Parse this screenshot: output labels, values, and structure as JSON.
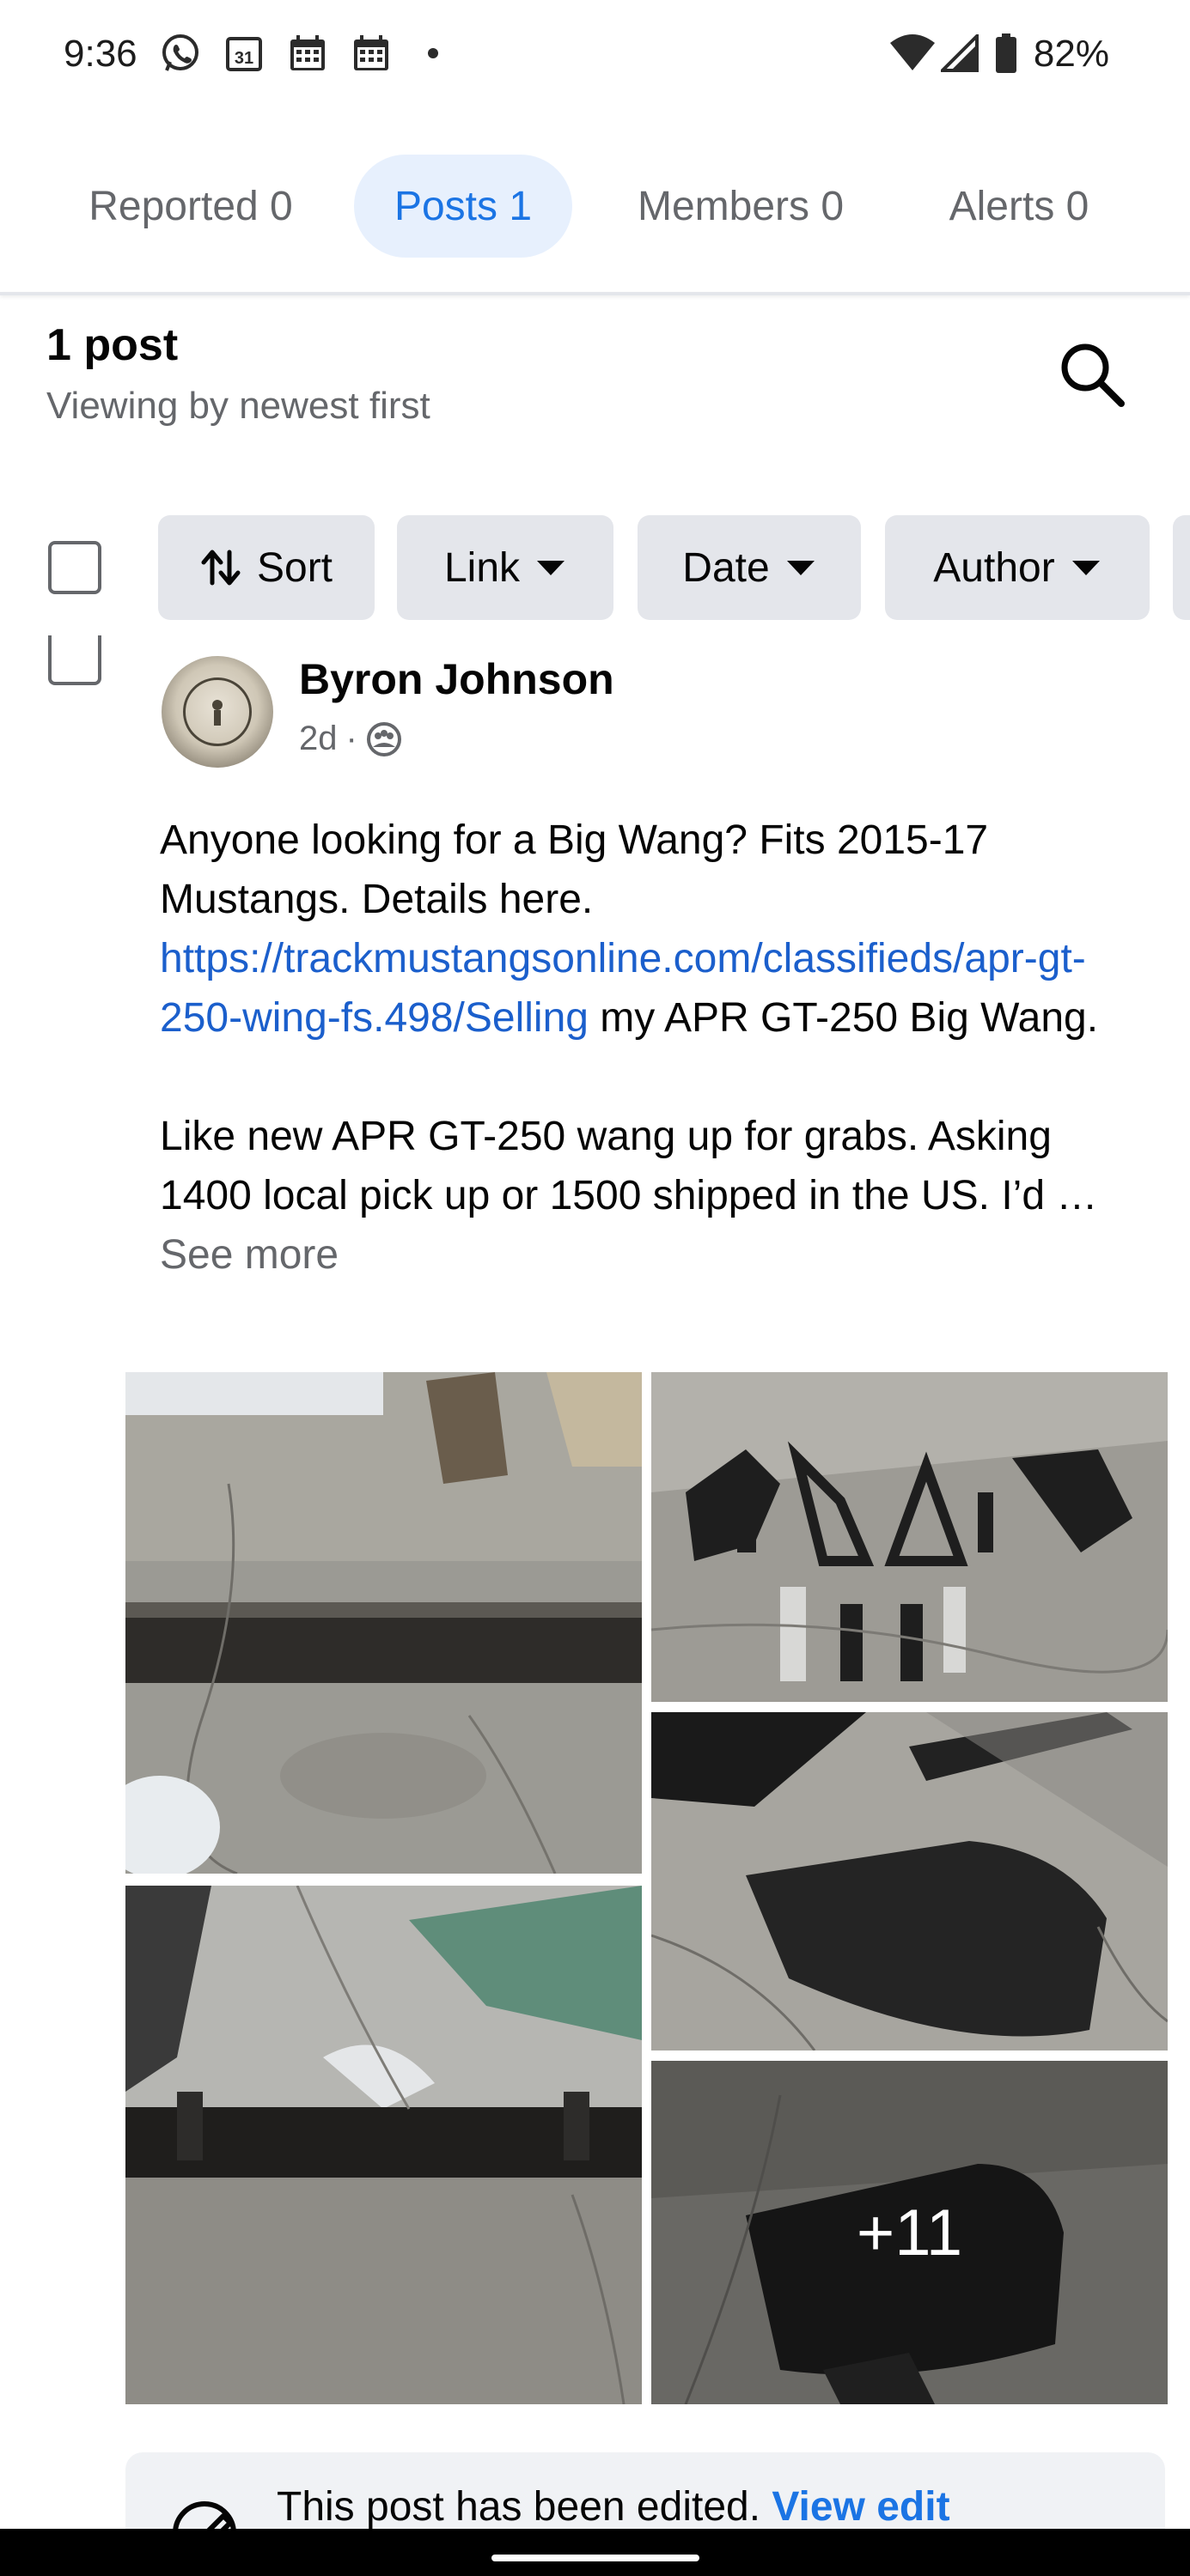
{
  "status_bar": {
    "time": "9:36",
    "calendar_day": "31",
    "battery": "82%",
    "icons": [
      "whatsapp-icon",
      "calendar-icon",
      "calendar-grid-icon",
      "calendar-grid-icon",
      "dot-icon",
      "wifi-icon",
      "signal-icon",
      "battery-icon"
    ]
  },
  "tabs": [
    {
      "label": "Reported 0",
      "active": false
    },
    {
      "label": "Posts 1",
      "active": true
    },
    {
      "label": "Members 0",
      "active": false
    },
    {
      "label": "Alerts 0",
      "active": false
    }
  ],
  "summary": {
    "count": "1 post",
    "sort_description": "Viewing by newest first"
  },
  "filters": [
    {
      "label": "Sort",
      "icon": "sort-arrows-icon"
    },
    {
      "label": "Link",
      "icon": "caret-down-icon"
    },
    {
      "label": "Date",
      "icon": "caret-down-icon"
    },
    {
      "label": "Author",
      "icon": "caret-down-icon"
    }
  ],
  "post": {
    "author": "Byron Johnson",
    "time": "2d",
    "audience_separator": "·",
    "text_line_1": "Anyone looking for a Big Wang? Fits 2015-17 Mustangs. Details here.",
    "link": "https://trackmustangsonline.com/classifieds/apr-gt-250-wing-fs.498/Selling",
    "text_after_link": " my APR GT-250 Big Wang.",
    "text_para_2": "Like new APR GT-250 wang up for grabs. Asking 1400 local pick up or 1500 shipped in the US. I’d …",
    "see_more": " See more",
    "more_photos": "+11"
  },
  "edited_notice": {
    "text": "This post has been edited. ",
    "link": "View edit"
  },
  "colors": {
    "accent": "#1b74e4",
    "tab_active_bg": "#e7f0fd",
    "chip_bg": "#e4e6eb",
    "secondary_text": "#65676b",
    "link_text": "#1b5fcc"
  }
}
